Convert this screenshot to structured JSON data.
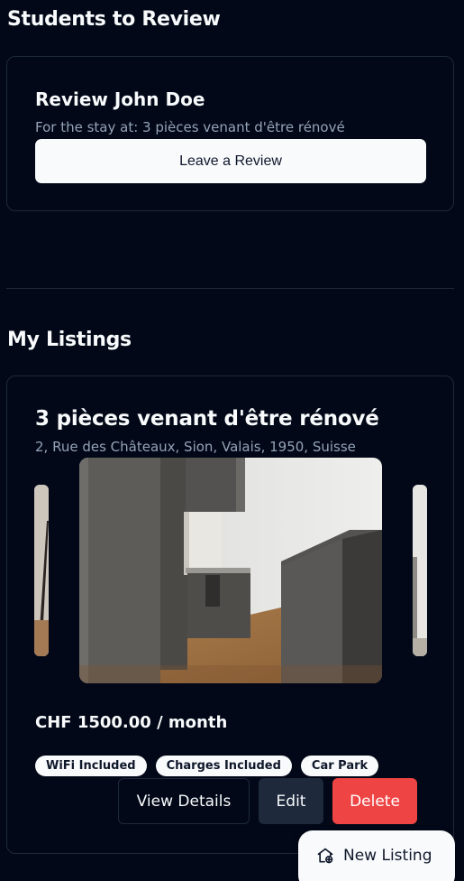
{
  "review_section": {
    "title": "Students to Review",
    "card": {
      "name": "Review John Doe",
      "stay": "For the stay at: 3 pièces venant d'être rénové",
      "button": "Leave a Review"
    }
  },
  "listings_section": {
    "title": "My Listings",
    "listing": {
      "title": "3 pièces venant d'être rénové",
      "address": "2, Rue des Châteaux, Sion, Valais, 1950, Suisse",
      "price": "CHF 1500.00 / month",
      "tags": [
        "WiFi Included",
        "Charges Included",
        "Car Park"
      ],
      "actions": {
        "view": "View Details",
        "edit": "Edit",
        "delete": "Delete"
      }
    }
  },
  "fab": {
    "label": "New Listing",
    "icon": "house-plus-icon"
  },
  "colors": {
    "background": "#020817",
    "border": "#1e293b",
    "muted_text": "#94a3b8",
    "primary_button": "#f8fafc",
    "danger": "#ef4444"
  }
}
